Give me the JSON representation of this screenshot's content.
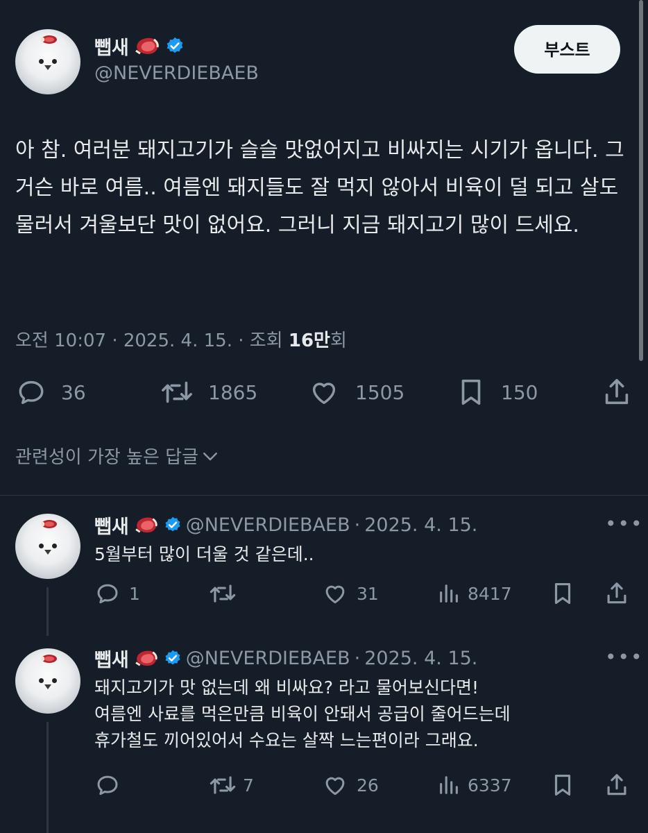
{
  "main_tweet": {
    "author_name": "뺍새",
    "handle": "@NEVERDIEBAEB",
    "boost_label": "부스트",
    "text": "아 참. 여러분 돼지고기가 슬슬 맛없어지고 비싸지는 시기가 옵니다. 그거슨 바로 여름.. 여름엔 돼지들도 잘 먹지 않아서 비육이 덜 되고 살도 물러서 겨울보단 맛이 없어요. 그러니 지금 돼지고기 많이 드세요.",
    "time": "오전 10:07",
    "date": "2025. 4. 15.",
    "views_label": "조회",
    "views_count": "16만",
    "views_suffix": "회",
    "replies": "36",
    "reposts": "1865",
    "likes": "1505",
    "bookmarks": "150"
  },
  "sort_label": "관련성이 가장 높은 답글",
  "replies": [
    {
      "author_name": "뺍새",
      "handle": "@NEVERDIEBAEB",
      "date": "2025. 4. 15.",
      "text": "5월부터 많이 더울 것 같은데..",
      "replies": "1",
      "reposts": "",
      "likes": "31",
      "views": "8417"
    },
    {
      "author_name": "뺍새",
      "handle": "@NEVERDIEBAEB",
      "date": "2025. 4. 15.",
      "text_lines": [
        "돼지고기가 맛 없는데 왜 비싸요? 라고 물어보신다면!",
        "여름엔 사료를 먹은만큼 비육이 안돼서 공급이 줄어드는데",
        "휴가철도 끼어있어서 수요는 살짝 느는편이라 그래요."
      ],
      "replies": "",
      "reposts": "7",
      "likes": "26",
      "views": "6337"
    }
  ],
  "colors": {
    "background": "#151d28",
    "text": "#e7e9ea",
    "secondary": "#8b98a5",
    "verified": "#1d9bf0"
  },
  "icons": [
    "meat-emoji-icon",
    "verified-badge-icon",
    "reply-icon",
    "repost-icon",
    "like-icon",
    "bookmark-icon",
    "share-icon",
    "views-icon",
    "more-icon",
    "chevron-down-icon"
  ]
}
